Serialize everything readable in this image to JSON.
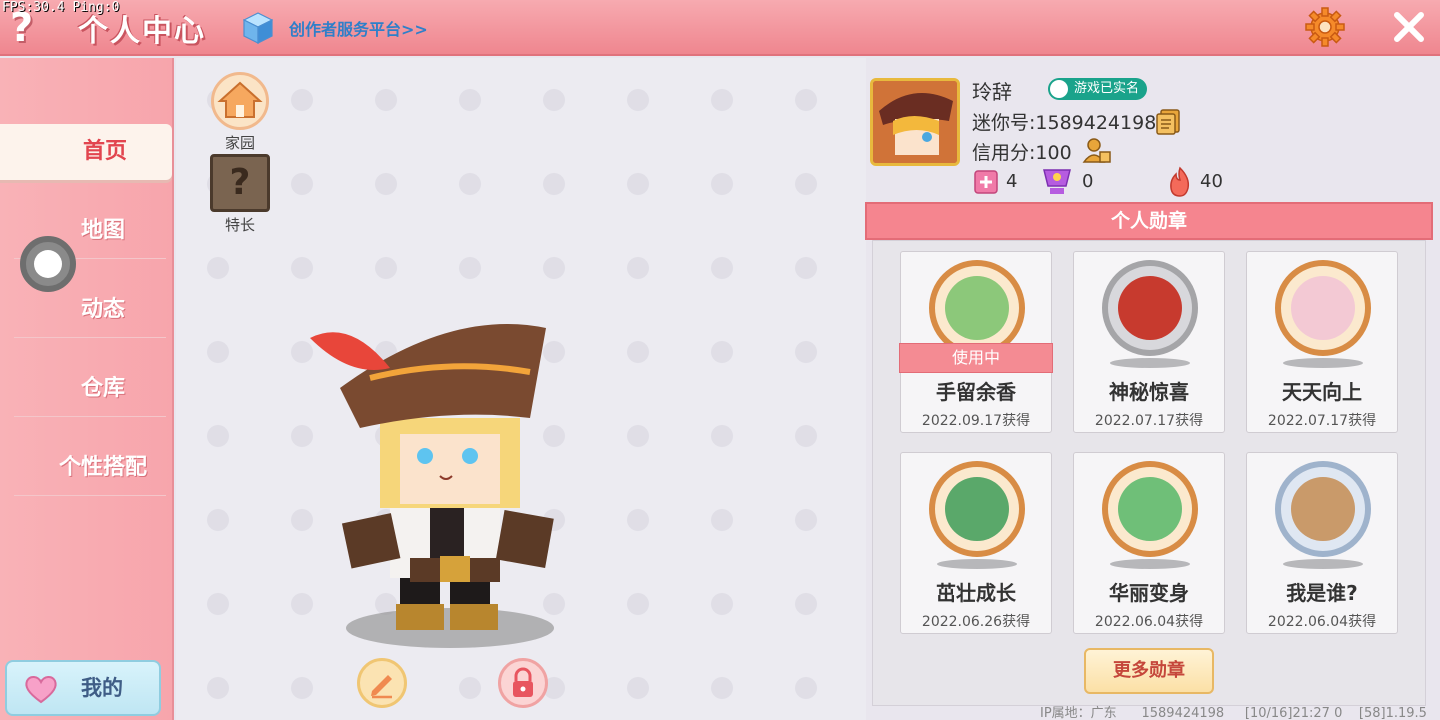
{
  "debug": {
    "fps": "FPS:30.4  Ping:0"
  },
  "header": {
    "title": "个人中心",
    "creator_link": "创作者服务平台>>",
    "colors": {
      "bar": "#ef868f",
      "link": "#2f7fc9"
    }
  },
  "sidebar": {
    "items": [
      {
        "label": "首页",
        "active": true
      },
      {
        "label": "地图"
      },
      {
        "label": "动态"
      },
      {
        "label": "仓库"
      },
      {
        "label": "个性搭配"
      }
    ],
    "mine_button": "我的"
  },
  "shortcuts": {
    "home": "家园",
    "special": "特长"
  },
  "profile": {
    "name": "玲辞",
    "verified_badge": "游戏已实名",
    "mini_id": "迷你号:1589424198",
    "credit": "信用分:100",
    "stats": {
      "a": "4",
      "b": "0",
      "c": "40"
    }
  },
  "medals": {
    "header": "个人勋章",
    "in_use_label": "使用中",
    "items": [
      {
        "name": "手留余香",
        "date": "2022.09.17获得",
        "in_use": true,
        "frame": "gold"
      },
      {
        "name": "神秘惊喜",
        "date": "2022.07.17获得",
        "frame": "silver"
      },
      {
        "name": "天天向上",
        "date": "2022.07.17获得",
        "frame": "gold"
      },
      {
        "name": "茁壮成长",
        "date": "2022.06.26获得",
        "frame": "gold"
      },
      {
        "name": "华丽变身",
        "date": "2022.06.04获得",
        "frame": "gold"
      },
      {
        "name": "我是谁?",
        "date": "2022.06.04获得",
        "frame": "silver"
      }
    ],
    "more_button": "更多勋章"
  },
  "footer": {
    "ip": "IP属地：广东",
    "uid": "1589424198",
    "time": "[10/16]21:27 0",
    "version": "[58]1.19.5"
  }
}
